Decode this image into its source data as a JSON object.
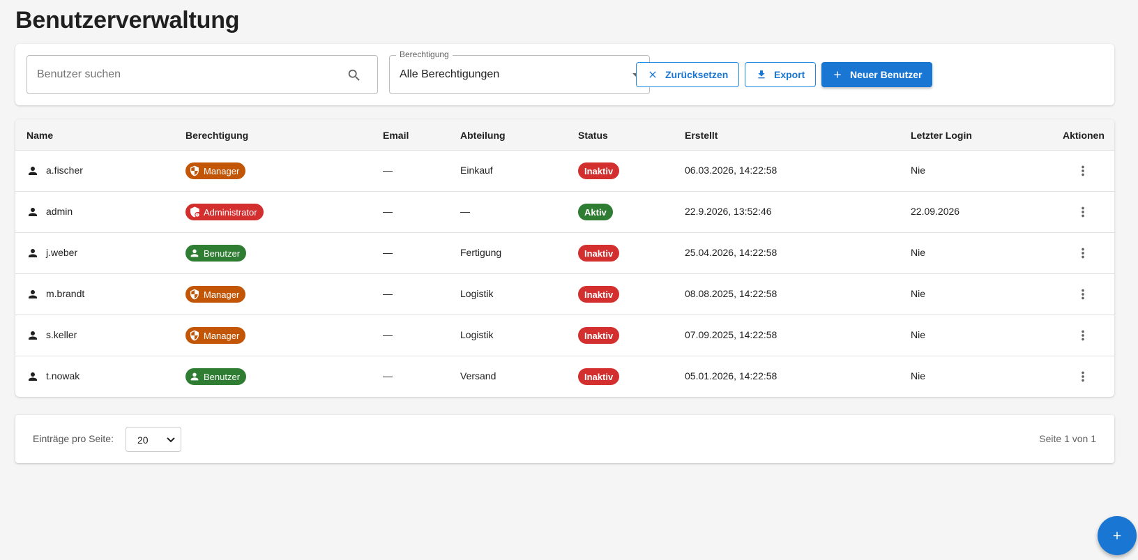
{
  "page": {
    "title": "Benutzerverwaltung"
  },
  "filters": {
    "search_placeholder": "Benutzer suchen",
    "search_value": "",
    "permission_label": "Berechtigung",
    "permission_value": "Alle Berechtigungen",
    "reset_label": "Zurücksetzen",
    "export_label": "Export",
    "new_user_label": "Neuer Benutzer"
  },
  "table": {
    "headers": {
      "name": "Name",
      "permission": "Berechtigung",
      "email": "Email",
      "department": "Abteilung",
      "status": "Status",
      "created": "Erstellt",
      "last_login": "Letzter Login",
      "actions": "Aktionen"
    },
    "rows": [
      {
        "name": "a.fischer",
        "role": "Manager",
        "email": "—",
        "department": "Einkauf",
        "status": "Inaktiv",
        "created": "06.03.2026, 14:22:58",
        "last_login": "Nie"
      },
      {
        "name": "admin",
        "role": "Administrator",
        "email": "—",
        "department": "—",
        "status": "Aktiv",
        "created": "22.9.2026, 13:52:46",
        "last_login": "22.09.2026"
      },
      {
        "name": "j.weber",
        "role": "Benutzer",
        "email": "—",
        "department": "Fertigung",
        "status": "Inaktiv",
        "created": "25.04.2026, 14:22:58",
        "last_login": "Nie"
      },
      {
        "name": "m.brandt",
        "role": "Manager",
        "email": "—",
        "department": "Logistik",
        "status": "Inaktiv",
        "created": "08.08.2025, 14:22:58",
        "last_login": "Nie"
      },
      {
        "name": "s.keller",
        "role": "Manager",
        "email": "—",
        "department": "Logistik",
        "status": "Inaktiv",
        "created": "07.09.2025, 14:22:58",
        "last_login": "Nie"
      },
      {
        "name": "t.nowak",
        "role": "Benutzer",
        "email": "—",
        "department": "Versand",
        "status": "Inaktiv",
        "created": "05.01.2026, 14:22:58",
        "last_login": "Nie"
      }
    ]
  },
  "pagination": {
    "per_page_label": "Einträge pro Seite:",
    "per_page_value": "20",
    "page_info": "Seite 1 von 1"
  },
  "colors": {
    "primary": "#1976d2",
    "manager": "#c25606",
    "administrator": "#d32f2f",
    "benutzer": "#2e7d32",
    "inaktiv": "#d32f2f",
    "aktiv": "#2e7d32"
  },
  "icons": {
    "search": "search-icon",
    "reset": "close-icon",
    "export": "download-icon",
    "new_user": "plus-icon",
    "row_user": "person-icon",
    "manager": "shield-icon",
    "administrator": "admin-shield-icon",
    "benutzer": "person-icon",
    "actions": "more-vertical-icon",
    "fab": "plus-icon"
  }
}
